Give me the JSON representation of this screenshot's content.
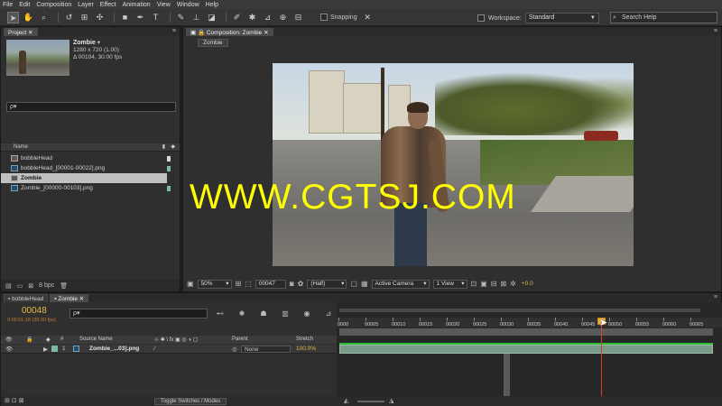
{
  "menu": [
    "File",
    "Edit",
    "Composition",
    "Layer",
    "Effect",
    "Animation",
    "View",
    "Window",
    "Help"
  ],
  "toolbar": {
    "snapping_label": "Snapping",
    "workspace_label": "Workspace:",
    "workspace_value": "Standard",
    "search_placeholder": "Search Help"
  },
  "project": {
    "tab": "Project",
    "selected_name": "Zombie",
    "selected_dims": "1280 x 720 (1.00)",
    "selected_duration": "Δ 00104, 30.00 fps",
    "search_value": "ρ▾",
    "column_name": "Name",
    "items": [
      {
        "name": "bobbleHead",
        "type": "comp"
      },
      {
        "name": "bobbleHead_[00001-00022].png",
        "type": "footage"
      },
      {
        "name": "Zombie",
        "type": "comp"
      },
      {
        "name": "Zombie_[00000-00103].png",
        "type": "footage"
      }
    ],
    "bpc": "8 bpc"
  },
  "composition": {
    "tab": "Composition: Zombie",
    "subtab": "Zombie",
    "zoom": "50%",
    "frame": "00047",
    "resolution": "(Half)",
    "camera": "Active Camera",
    "views": "1 View",
    "exposure": "+0.0"
  },
  "watermark": "WWW.CGTSJ.COM",
  "timeline": {
    "tabs": [
      "bobbleHead",
      "Zombie"
    ],
    "timecode": "00048",
    "timecode_sub": "0:00:01:18 (30.00 fps)",
    "search_value": "ρ▾",
    "columns": {
      "num": "#",
      "source": "Source Name",
      "parent": "Parent",
      "stretch": "Stretch"
    },
    "layer": {
      "num": "1",
      "name": "Zombie_...03].png",
      "parent": "None",
      "stretch": "100.0%"
    },
    "ruler": [
      "0000",
      "00005",
      "00010",
      "00015",
      "00020",
      "00025",
      "00030",
      "00035",
      "00040",
      "00045",
      "00050",
      "00055",
      "00060",
      "00065"
    ],
    "toggle_label": "Toggle Switches / Modes"
  },
  "colors": {
    "accent": "#e6b84a",
    "cti": "#e03a2a",
    "watermark": "#ffff00"
  }
}
